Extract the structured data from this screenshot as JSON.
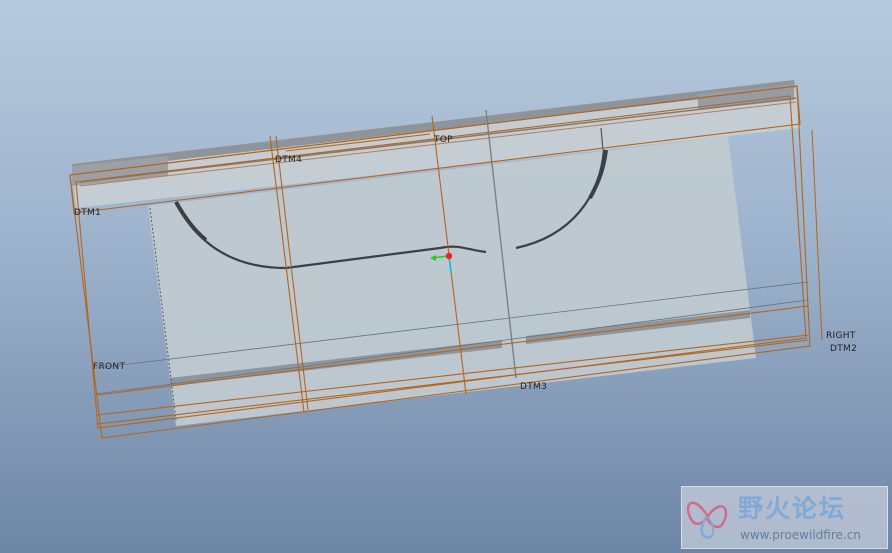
{
  "viewport": {
    "background_top": "#b7c9dd",
    "background_bottom": "#6e86a6"
  },
  "datums": {
    "dtm1": "DTM1",
    "dtm2": "DTM2",
    "dtm3": "DTM3",
    "dtm4": "DTM4",
    "top": "TOP",
    "front": "FRONT",
    "right": "RIGHT"
  },
  "colors": {
    "datum_plane": "#b5651d",
    "part_face": "#bfc9d0",
    "part_edge": "#8d9399",
    "sketch_curve": "#3c4046",
    "csys_x": "#22cc22",
    "csys_y": "#00c8c8",
    "csys_z": "#ee2222"
  },
  "watermark": {
    "title": "野火论坛",
    "url": "www.proewildfire.cn"
  }
}
